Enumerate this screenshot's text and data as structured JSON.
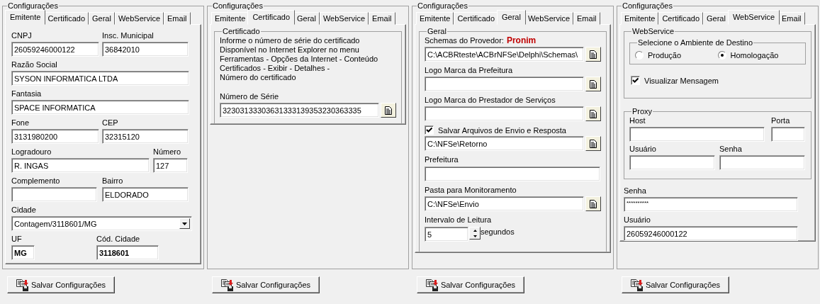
{
  "panels": [
    {
      "kind": "emitente",
      "group_title": "Configurações",
      "tabs": [
        {
          "label": "Emitente",
          "selected": true
        },
        {
          "label": "Certificado",
          "selected": false
        },
        {
          "label": "Geral",
          "selected": false
        },
        {
          "label": "WebService",
          "selected": false
        },
        {
          "label": "Email",
          "selected": false
        }
      ],
      "rows": [
        [
          {
            "kind": "text",
            "label": "CNPJ",
            "value": "26059246000122"
          },
          {
            "kind": "text",
            "label": "Insc. Municipal",
            "value": "36842010"
          }
        ],
        [
          {
            "kind": "text",
            "label": "Razão Social",
            "value": "SYSON INFORMATICA LTDA"
          }
        ],
        [
          {
            "kind": "text",
            "label": "Fantasia",
            "value": "SPACE INFORMATICA"
          }
        ],
        [
          {
            "kind": "text",
            "label": "Fone",
            "value": "3131980200"
          },
          {
            "kind": "text",
            "label": "CEP",
            "value": "32315120"
          }
        ],
        [
          {
            "kind": "text",
            "label": "Logradouro",
            "value": "R. INGAS"
          },
          {
            "kind": "text",
            "label": "Número",
            "value": "127"
          }
        ],
        [
          {
            "kind": "text",
            "label": "Complemento"
          },
          {
            "kind": "text",
            "label": "Bairro",
            "value": "ELDORADO"
          }
        ],
        [
          {
            "kind": "combo",
            "label": "Cidade",
            "value": "Contagem/3118601/MG"
          }
        ],
        [
          {
            "kind": "bold",
            "label": "UF",
            "value": "MG"
          },
          {
            "kind": "bold",
            "label": "Cód. Cidade",
            "value": "3118601"
          }
        ]
      ],
      "save_button": "Salvar Configurações"
    },
    {
      "kind": "certificado",
      "group_title": "Configurações",
      "tabs": [
        {
          "label": "Emitente",
          "selected": false
        },
        {
          "label": "Certificado",
          "selected": true
        },
        {
          "label": "Geral",
          "selected": false
        },
        {
          "label": "WebService",
          "selected": false
        },
        {
          "label": "Email",
          "selected": false
        }
      ],
      "section": {
        "title": "Certificado",
        "instructions": [
          "Informe o número de série do certificado",
          "Disponível no Internet Explorer no menu",
          "Ferramentas - Opções da Internet - Conteúdo",
          "Certificados - Exibir - Detalhes -",
          "Número do certificado"
        ],
        "serial_label": "Número de Série",
        "serial_value": "32303133303631333139353230363335"
      },
      "save_button": "Salvar Configurações"
    },
    {
      "kind": "geral",
      "group_title": "Configurações",
      "tabs": [
        {
          "label": "Emitente",
          "selected": false
        },
        {
          "label": "Certificado",
          "selected": false
        },
        {
          "label": "Geral",
          "selected": true
        },
        {
          "label": "WebService",
          "selected": false
        },
        {
          "label": "Email",
          "selected": false
        }
      ],
      "section": {
        "title": "Geral",
        "items": [
          {
            "kind": "browse",
            "label": "Schemas do Provedor:",
            "highlight": "Pronim",
            "value": "C:\\ACBRteste\\ACBrNFSe\\Delphi\\Schemas\\"
          },
          {
            "kind": "browse",
            "label": "Logo Marca da Prefeitura"
          },
          {
            "kind": "browse",
            "label": "Logo Marca do Prestador de Serviços"
          },
          {
            "kind": "check-browse",
            "label": "Salvar Arquivos de Envio e Resposta",
            "checked": true,
            "value": "C:\\NFSe\\Retorno"
          },
          {
            "kind": "field",
            "label": "Prefeitura"
          },
          {
            "kind": "browse",
            "label": "Pasta para Monitoramento",
            "value": "C:\\NFSe\\Envio"
          },
          {
            "kind": "spin",
            "label": "Intervalo de Leitura",
            "value": "5",
            "unit": "segundos"
          }
        ]
      },
      "save_button": "Salvar Configurações"
    },
    {
      "kind": "webservice",
      "group_title": "Configurações",
      "tabs": [
        {
          "label": "Emitente",
          "selected": false
        },
        {
          "label": "Certificado",
          "selected": false
        },
        {
          "label": "Geral",
          "selected": false
        },
        {
          "label": "WebService",
          "selected": true
        },
        {
          "label": "Email",
          "selected": false
        }
      ],
      "webservice": {
        "title": "WebService",
        "environment": {
          "title": "Selecione o Ambiente de Destino",
          "options": [
            {
              "label": "Produção",
              "selected": false
            },
            {
              "label": "Homologação",
              "selected": true
            }
          ]
        },
        "show_message": {
          "label": "Visualizar Mensagem",
          "checked": true
        }
      },
      "proxy": {
        "title": "Proxy",
        "fields": [
          {
            "label": "Host"
          },
          {
            "label": "Porta"
          },
          {
            "label": "Usuário"
          },
          {
            "label": "Senha"
          }
        ]
      },
      "credentials": [
        {
          "label": "Senha",
          "value": "**********"
        },
        {
          "label": "Usuário",
          "value": "26059246000122"
        }
      ],
      "save_button": "Salvar Configurações"
    }
  ]
}
